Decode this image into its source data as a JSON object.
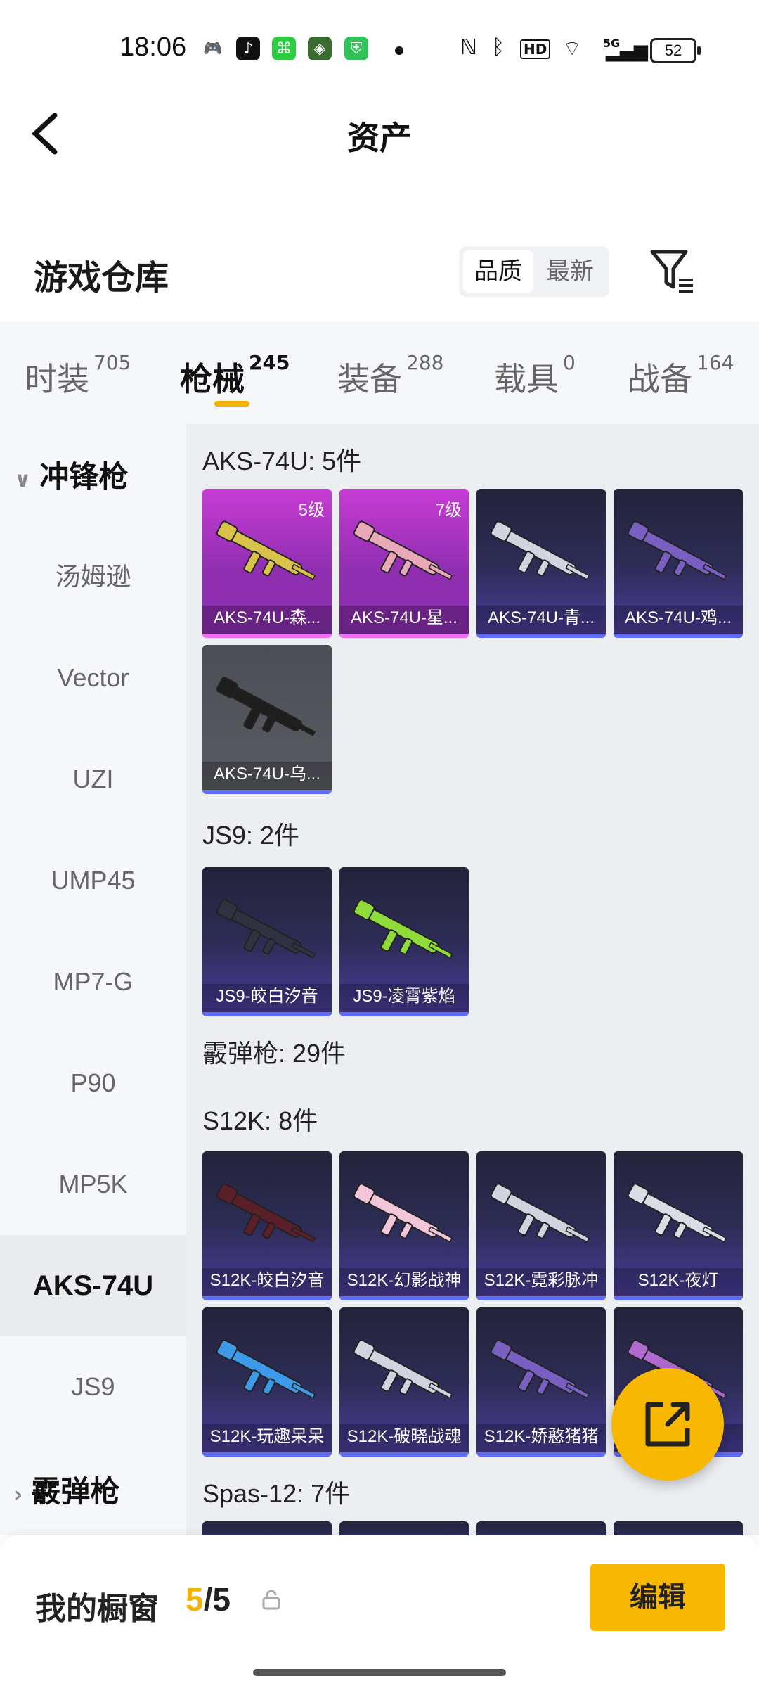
{
  "status_bar": {
    "time": "18:06",
    "battery": "52",
    "network": "5G"
  },
  "header": {
    "title": "资产",
    "back_icon": "chevron-left-icon"
  },
  "section": {
    "title": "游戏仓库",
    "sort_options": [
      "品质",
      "最新"
    ],
    "selected_sort": "品质"
  },
  "tabs": [
    {
      "label": "时装",
      "count": "705"
    },
    {
      "label": "枪械",
      "count": "245",
      "active": true
    },
    {
      "label": "装备",
      "count": "288"
    },
    {
      "label": "载具",
      "count": "0"
    },
    {
      "label": "战备",
      "count": "164"
    }
  ],
  "sidebar": {
    "group1": "冲锋枪",
    "items": [
      "汤姆逊",
      "Vector",
      "UZI",
      "UMP45",
      "MP7-G",
      "P90",
      "MP5K",
      "AKS-74U",
      "JS9"
    ],
    "active_item": "AKS-74U",
    "group2": "霰弹枪"
  },
  "groups": [
    {
      "title": "AKS-74U: 5件",
      "cards": [
        {
          "label": "AKS-74U-森...",
          "level": "5级",
          "style": "purple"
        },
        {
          "label": "AKS-74U-星...",
          "level": "7级",
          "style": "purple"
        },
        {
          "label": "AKS-74U-青...",
          "style": "blue"
        },
        {
          "label": "AKS-74U-鸡...",
          "style": "blue"
        },
        {
          "label": "AKS-74U-乌...",
          "style": "gray"
        }
      ]
    },
    {
      "title": "JS9: 2件",
      "cards": [
        {
          "label": "JS9-皎白汐音",
          "style": "blue"
        },
        {
          "label": "JS9-凌霄紫焰",
          "style": "blue"
        }
      ]
    },
    {
      "title": "霰弹枪: 29件"
    },
    {
      "title": "S12K: 8件",
      "cards": [
        {
          "label": "S12K-皎白汐音",
          "style": "blue"
        },
        {
          "label": "S12K-幻影战神",
          "style": "blue"
        },
        {
          "label": "S12K-霓彩脉冲",
          "style": "blue"
        },
        {
          "label": "S12K-夜灯",
          "style": "blue"
        },
        {
          "label": "S12K-玩趣呆呆",
          "style": "blue"
        },
        {
          "label": "S12K-破晓战魂",
          "style": "blue"
        },
        {
          "label": "S12K-娇憨猪猪",
          "style": "blue"
        },
        {
          "label": "",
          "style": "blue"
        }
      ]
    },
    {
      "title": "Spas-12: 7件"
    }
  ],
  "bottom": {
    "window_label": "我的橱窗",
    "current": "5",
    "total": "/5",
    "edit_label": "编辑"
  },
  "colors": {
    "accent": "#f8b700",
    "purple_card": "#b83acc",
    "blue_card": "#2d2c55"
  }
}
